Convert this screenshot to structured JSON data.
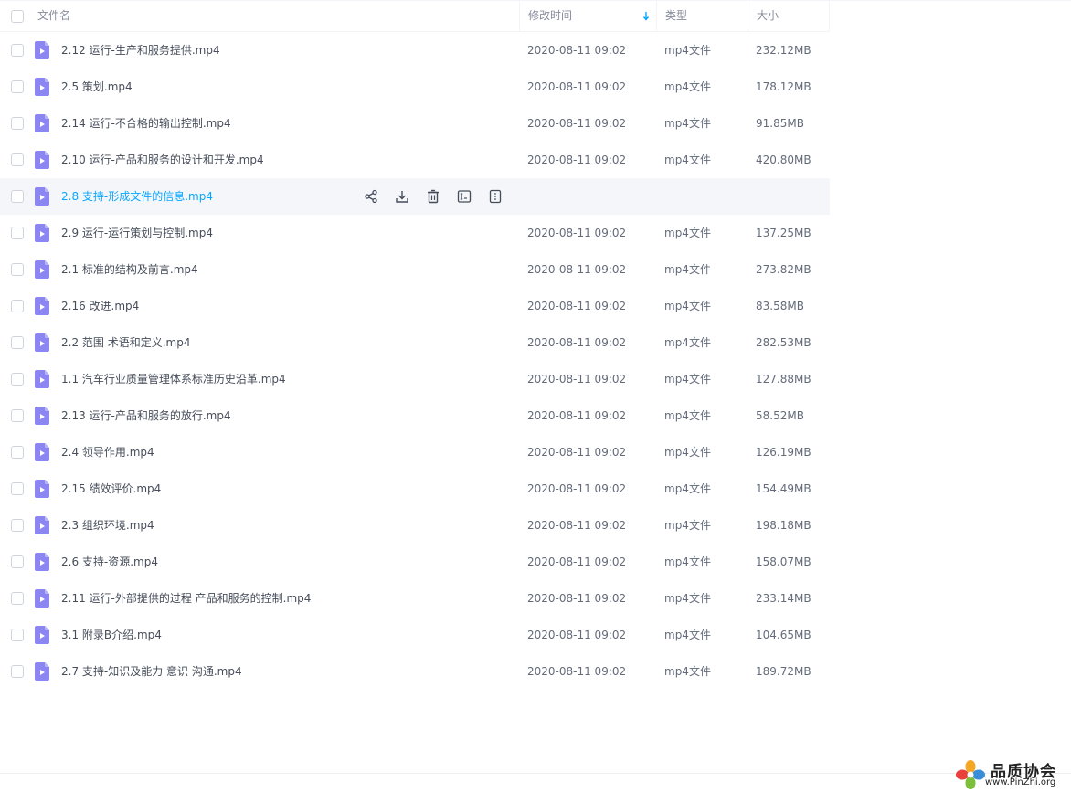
{
  "header": {
    "name": "文件名",
    "time": "修改时间",
    "type": "类型",
    "size": "大小"
  },
  "accent_color": "#06a7ff",
  "icons": {
    "file": "video-file-icon",
    "sort": "sort-desc-arrow-icon",
    "actions": [
      "share-icon",
      "download-icon",
      "delete-icon",
      "rename-icon",
      "more-icon"
    ]
  },
  "files": [
    {
      "name": "2.12 运行-生产和服务提供.mp4",
      "time": "2020-08-11 09:02",
      "type": "mp4文件",
      "size": "232.12MB"
    },
    {
      "name": "2.5 策划.mp4",
      "time": "2020-08-11 09:02",
      "type": "mp4文件",
      "size": "178.12MB"
    },
    {
      "name": "2.14 运行-不合格的输出控制.mp4",
      "time": "2020-08-11 09:02",
      "type": "mp4文件",
      "size": "91.85MB"
    },
    {
      "name": "2.10 运行-产品和服务的设计和开发.mp4",
      "time": "2020-08-11 09:02",
      "type": "mp4文件",
      "size": "420.80MB"
    },
    {
      "name": "2.8 支持-形成文件的信息.mp4",
      "time": "",
      "type": "",
      "size": ""
    },
    {
      "name": "2.9 运行-运行策划与控制.mp4",
      "time": "2020-08-11 09:02",
      "type": "mp4文件",
      "size": "137.25MB"
    },
    {
      "name": "2.1 标准的结构及前言.mp4",
      "time": "2020-08-11 09:02",
      "type": "mp4文件",
      "size": "273.82MB"
    },
    {
      "name": "2.16 改进.mp4",
      "time": "2020-08-11 09:02",
      "type": "mp4文件",
      "size": "83.58MB"
    },
    {
      "name": "2.2 范围 术语和定义.mp4",
      "time": "2020-08-11 09:02",
      "type": "mp4文件",
      "size": "282.53MB"
    },
    {
      "name": "1.1 汽车行业质量管理体系标准历史沿革.mp4",
      "time": "2020-08-11 09:02",
      "type": "mp4文件",
      "size": "127.88MB"
    },
    {
      "name": "2.13 运行-产品和服务的放行.mp4",
      "time": "2020-08-11 09:02",
      "type": "mp4文件",
      "size": "58.52MB"
    },
    {
      "name": "2.4 领导作用.mp4",
      "time": "2020-08-11 09:02",
      "type": "mp4文件",
      "size": "126.19MB"
    },
    {
      "name": "2.15 绩效评价.mp4",
      "time": "2020-08-11 09:02",
      "type": "mp4文件",
      "size": "154.49MB"
    },
    {
      "name": "2.3 组织环境.mp4",
      "time": "2020-08-11 09:02",
      "type": "mp4文件",
      "size": "198.18MB"
    },
    {
      "name": "2.6 支持-资源.mp4",
      "time": "2020-08-11 09:02",
      "type": "mp4文件",
      "size": "158.07MB"
    },
    {
      "name": "2.11 运行-外部提供的过程 产品和服务的控制.mp4",
      "time": "2020-08-11 09:02",
      "type": "mp4文件",
      "size": "233.14MB"
    },
    {
      "name": "3.1 附录B介绍.mp4",
      "time": "2020-08-11 09:02",
      "type": "mp4文件",
      "size": "104.65MB"
    },
    {
      "name": "2.7 支持-知识及能力 意识 沟通.mp4",
      "time": "2020-08-11 09:02",
      "type": "mp4文件",
      "size": "189.72MB"
    }
  ],
  "watermark": {
    "title": "品质协会",
    "url": "www.PinZhi.org"
  }
}
